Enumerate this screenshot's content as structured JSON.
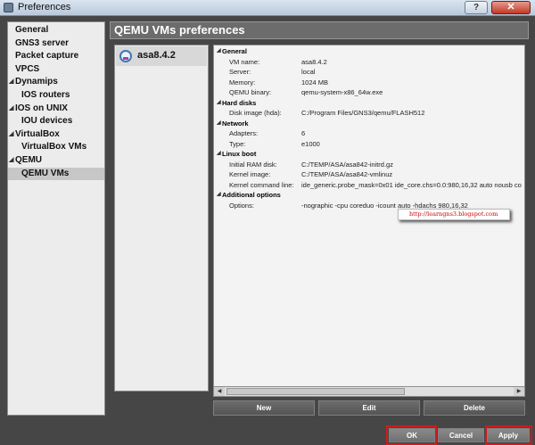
{
  "window": {
    "title": "Preferences",
    "help_label": "?",
    "close_label": "✕"
  },
  "sidebar": {
    "items": [
      {
        "label": "General",
        "level": 0,
        "expandable": false,
        "selected": false
      },
      {
        "label": "GNS3 server",
        "level": 0,
        "expandable": false,
        "selected": false
      },
      {
        "label": "Packet capture",
        "level": 0,
        "expandable": false,
        "selected": false
      },
      {
        "label": "VPCS",
        "level": 0,
        "expandable": false,
        "selected": false
      },
      {
        "label": "Dynamips",
        "level": 0,
        "expandable": true,
        "selected": false
      },
      {
        "label": "IOS routers",
        "level": 1,
        "expandable": false,
        "selected": false
      },
      {
        "label": "IOS on UNIX",
        "level": 0,
        "expandable": true,
        "selected": false
      },
      {
        "label": "IOU devices",
        "level": 1,
        "expandable": false,
        "selected": false
      },
      {
        "label": "VirtualBox",
        "level": 0,
        "expandable": true,
        "selected": false
      },
      {
        "label": "VirtualBox VMs",
        "level": 1,
        "expandable": false,
        "selected": false
      },
      {
        "label": "QEMU",
        "level": 0,
        "expandable": true,
        "selected": false
      },
      {
        "label": "QEMU VMs",
        "level": 1,
        "expandable": false,
        "selected": true
      }
    ]
  },
  "header": {
    "title": "QEMU VMs preferences"
  },
  "vm_list": {
    "items": [
      {
        "name": "asa8.4.2",
        "icon": "qemu-vm-icon"
      }
    ]
  },
  "details": {
    "sections": [
      {
        "title": "General",
        "rows": [
          {
            "key": "VM name:",
            "value": "asa8.4.2"
          },
          {
            "key": "Server:",
            "value": "local"
          },
          {
            "key": "Memory:",
            "value": "1024 MB"
          },
          {
            "key": "QEMU binary:",
            "value": "qemu-system-x86_64w.exe"
          }
        ]
      },
      {
        "title": "Hard disks",
        "rows": [
          {
            "key": "Disk image (hda):",
            "value": "C:/Program Files/GNS3/qemu/FLASH512"
          }
        ]
      },
      {
        "title": "Network",
        "rows": [
          {
            "key": "Adapters:",
            "value": "6"
          },
          {
            "key": "Type:",
            "value": "e1000"
          }
        ]
      },
      {
        "title": "Linux boot",
        "rows": [
          {
            "key": "Initial RAM disk:",
            "value": "C:/TEMP/ASA/asa842-initrd.gz"
          },
          {
            "key": "Kernel image:",
            "value": "C:/TEMP/ASA/asa842-vmlinuz"
          },
          {
            "key": "Kernel command line:",
            "value": "ide_generic.probe_mask=0x01 ide_core.chs=0.0:980,16,32 auto nousb co"
          }
        ]
      },
      {
        "title": "Additional options",
        "rows": [
          {
            "key": "Options:",
            "value": "-nographic -cpu coreduo -icount auto -hdachs 980,16,32"
          }
        ]
      }
    ],
    "watermark": "http://learngns3.blogspot.com"
  },
  "buttons": {
    "new": "New",
    "edit": "Edit",
    "delete": "Delete",
    "ok": "OK",
    "cancel": "Cancel",
    "apply": "Apply"
  },
  "colors": {
    "highlight": "#d21a1a",
    "header_bg": "#6c6c6c",
    "window_bg": "#464646"
  }
}
